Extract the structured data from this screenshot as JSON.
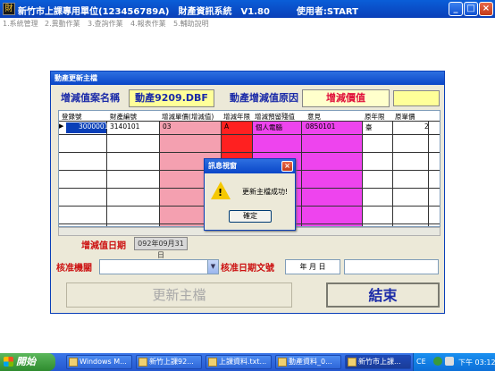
{
  "window": {
    "app_icon": "財",
    "title": "新竹市上課專用單位(123456789A)　財產資訊系統　V1.80　　　使用者:START",
    "btn_min": "_",
    "btn_max": "□",
    "btn_close": "×"
  },
  "menu": [
    "1.系統管理",
    "2.異動作業",
    "3.查詢作業",
    "4.報表作業",
    "5.輔助說明"
  ],
  "dialog": {
    "title": "動產更新主檔",
    "case_name_label": "增減值案名稱",
    "case_name_value": "動產9209.DBF",
    "reason_label": "動產增減值原因",
    "reason_value": "增減價值",
    "grid": {
      "headers": [
        "登錄號",
        "財產編號",
        "增減單價(增減值)",
        "增減年限",
        "增減預留殘值",
        "意見",
        "原年限",
        "原單價"
      ],
      "rows": [
        [
          "3000001",
          "3140101",
          "03",
          "A",
          "個人電腦",
          "0850101",
          "臺",
          "2"
        ]
      ],
      "row_marker": "▶"
    },
    "date_label": "增減值日期",
    "date_value": "092年09月31日",
    "approval_label": "核准機關",
    "approval_doc_label": "核准日期文號",
    "approval_date_value": "年 月 日",
    "update_button": "更新主檔",
    "end_button": "結束"
  },
  "message_box": {
    "title": "訊息視窗",
    "close": "×",
    "icon": "warning-icon",
    "icon_mark": "!",
    "text": "更新主檔成功!",
    "ok": "確定"
  },
  "taskbar": {
    "start": "開始",
    "tasks": [
      "Windows M...",
      "新竹上課92...",
      "上課資料.txt...",
      "動產資料_0...",
      "新竹市上課..."
    ],
    "tray_lang": "CE",
    "clock": "下午 03:12"
  },
  "colors": {
    "title_blue": "#0a46c8",
    "label_blue": "#1a2aa8",
    "label_red": "#cc1111",
    "pink_col": "#f4a0b0",
    "red_col": "#ff2020",
    "magenta_col": "#ee44ee"
  }
}
